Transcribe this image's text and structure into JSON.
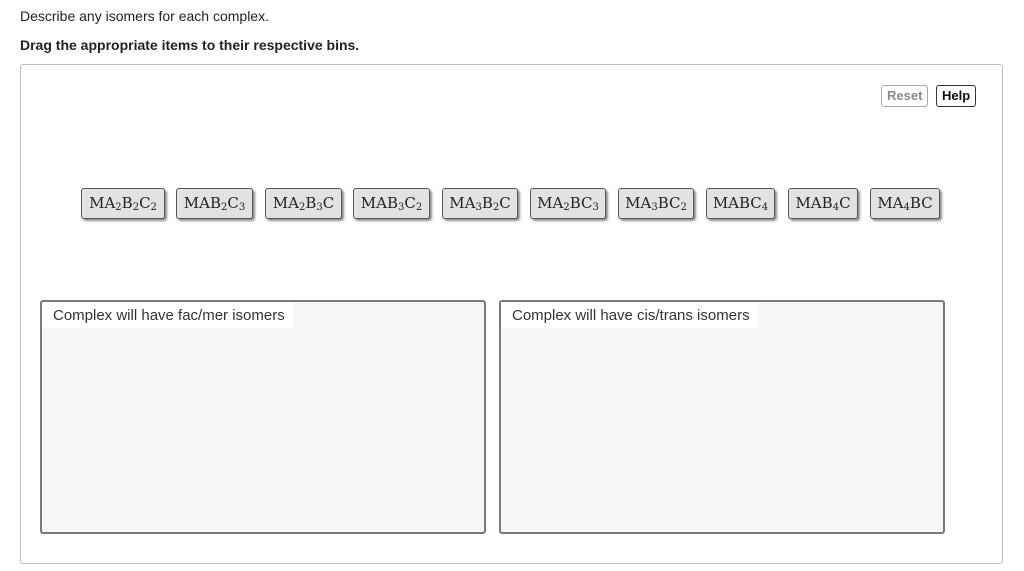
{
  "intro_text": "Describe any isomers for each complex.",
  "instruction_text": "Drag the appropriate items to their respective bins.",
  "buttons": {
    "reset": "Reset",
    "help": "Help"
  },
  "items": [
    {
      "id": "MA2B2C2",
      "parts": [
        [
          "M",
          ""
        ],
        [
          "A",
          "2"
        ],
        [
          "B",
          "2"
        ],
        [
          "C",
          "2"
        ]
      ]
    },
    {
      "id": "MAB2C3",
      "parts": [
        [
          "MA",
          ""
        ],
        [
          "B",
          "2"
        ],
        [
          "C",
          "3"
        ]
      ]
    },
    {
      "id": "MA2B3C",
      "parts": [
        [
          "M",
          ""
        ],
        [
          "A",
          "2"
        ],
        [
          "B",
          "3"
        ],
        [
          "C",
          ""
        ]
      ]
    },
    {
      "id": "MAB3C2",
      "parts": [
        [
          "MA",
          ""
        ],
        [
          "B",
          "3"
        ],
        [
          "C",
          "2"
        ]
      ]
    },
    {
      "id": "MA3B2C",
      "parts": [
        [
          "M",
          ""
        ],
        [
          "A",
          "3"
        ],
        [
          "B",
          "2"
        ],
        [
          "C",
          ""
        ]
      ]
    },
    {
      "id": "MA2BC3",
      "parts": [
        [
          "M",
          ""
        ],
        [
          "A",
          "2"
        ],
        [
          "BC",
          "3"
        ]
      ]
    },
    {
      "id": "MA3BC2",
      "parts": [
        [
          "M",
          ""
        ],
        [
          "A",
          "3"
        ],
        [
          "BC",
          "2"
        ]
      ]
    },
    {
      "id": "MABC4",
      "parts": [
        [
          "MABC",
          "4"
        ]
      ]
    },
    {
      "id": "MAB4C",
      "parts": [
        [
          "MA",
          ""
        ],
        [
          "B",
          "4"
        ],
        [
          "C",
          ""
        ]
      ]
    },
    {
      "id": "MA4BC",
      "parts": [
        [
          "M",
          ""
        ],
        [
          "A",
          "4"
        ],
        [
          "BC",
          ""
        ]
      ]
    }
  ],
  "bins": {
    "left_label": "Complex will have fac/mer isomers",
    "right_label": "Complex will have cis/trans isomers"
  }
}
